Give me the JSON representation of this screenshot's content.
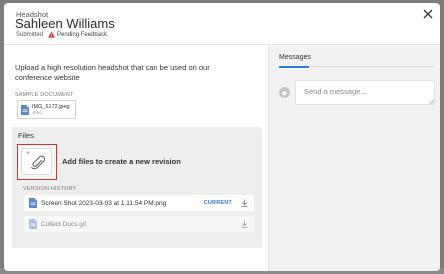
{
  "header": {
    "eyebrow": "Headshot",
    "title": "Sahleen Williams",
    "status_submitted": "Submitted",
    "status_pending": "Pending Feedback",
    "colors": {
      "warning": "#d9312b"
    }
  },
  "main": {
    "description": "Upload a high resolution headshot that can be used on our conference website",
    "sample_label": "SAMPLE DOCUMENT",
    "sample_doc": {
      "name": "IMG_6172.jpeg",
      "type": "JPEG",
      "icon": "file-icon"
    },
    "files": {
      "heading": "Files",
      "plus": "+",
      "add_text": "Add files to create a new revision",
      "upload_icon": "paperclip-icon",
      "highlight_color": "#d9312b"
    },
    "version_history": {
      "label": "VERSION HISTORY",
      "rows": [
        {
          "name": "Screen Shot 2023-03-03 at 1.11.54 PM.png",
          "badge": "CURRENT",
          "icon": "file-icon"
        },
        {
          "name": "Collect Docs.gif",
          "badge": "",
          "icon": "file-icon"
        }
      ]
    }
  },
  "messages": {
    "title": "Messages",
    "placeholder": "Send a message...",
    "accent": "#2d7ed6"
  }
}
